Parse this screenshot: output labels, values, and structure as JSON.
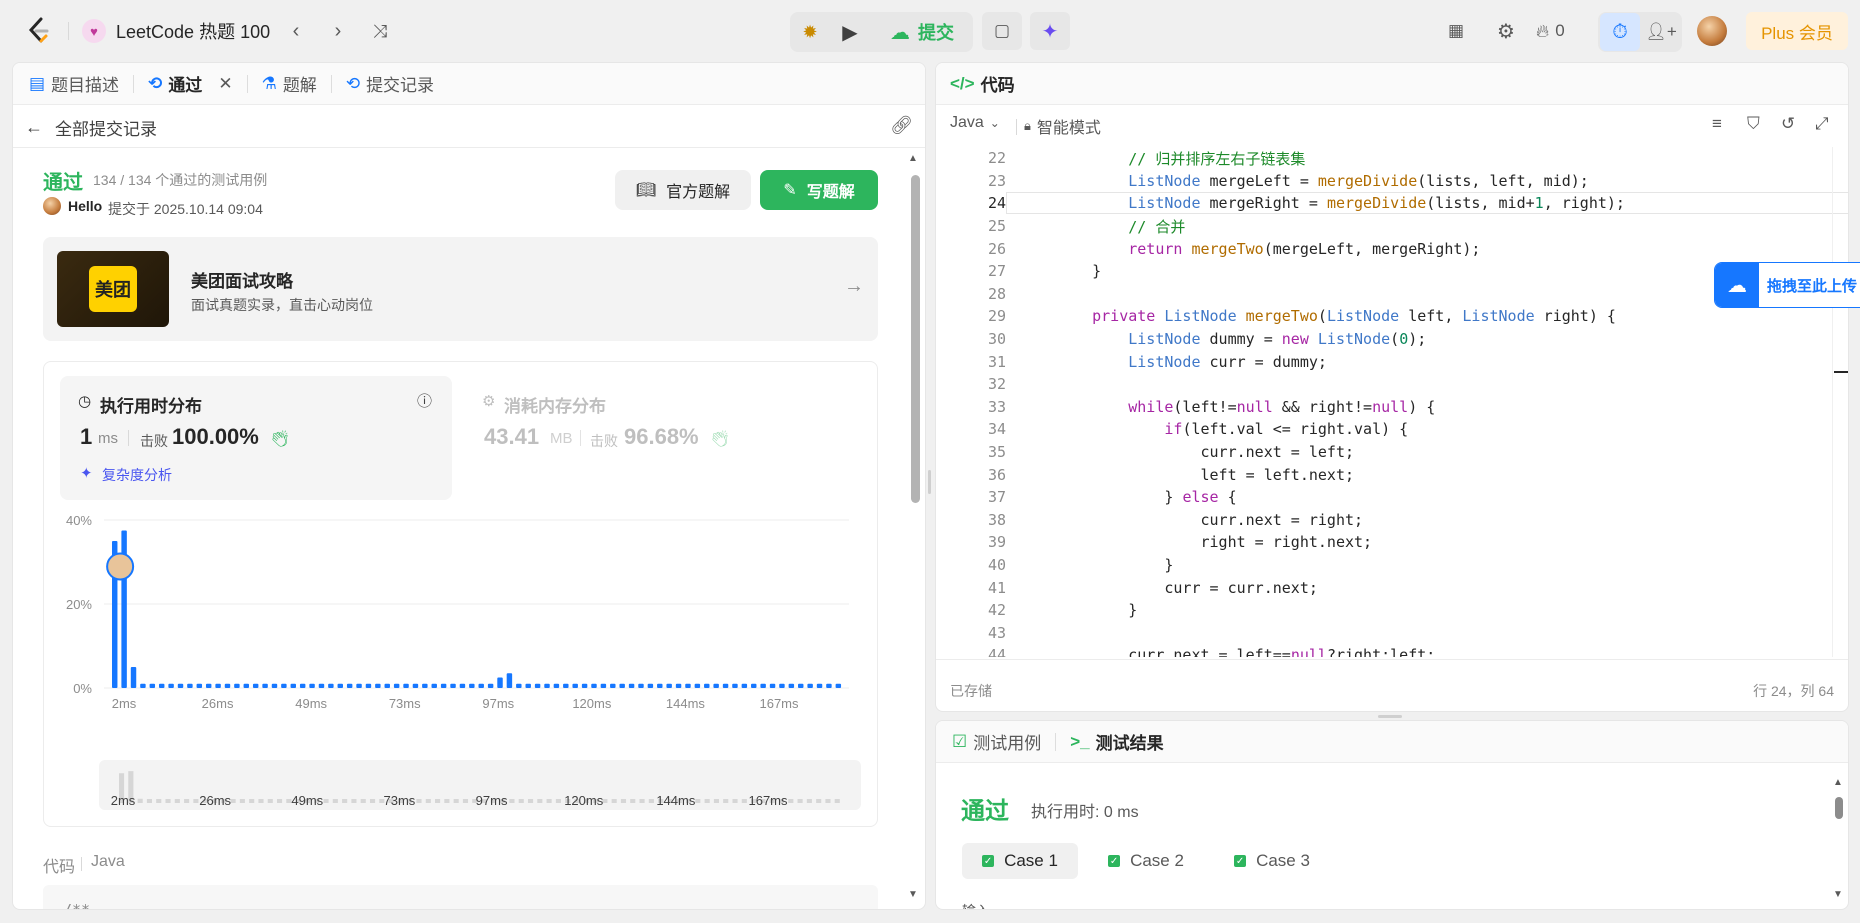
{
  "topbar": {
    "problem_list": "LeetCode 热题 100",
    "submit": "提交",
    "streak_count": "0",
    "plus": "Plus 会员"
  },
  "left": {
    "tabs": [
      "题目描述",
      "通过",
      "题解",
      "提交记录"
    ],
    "back_label": "全部提交记录",
    "status": "通过",
    "testcases": "134 / 134 个通过的测试用例",
    "user": "Hello",
    "submitted_at": "提交于 2025.10.14 09:04",
    "official_solution": "官方题解",
    "write_solution": "写题解",
    "promo_logo": "美团",
    "promo_title": "美团面试攻略",
    "promo_sub": "面试真题实录，直击心动岗位",
    "runtime_title": "执行用时分布",
    "runtime_value": "1",
    "runtime_unit": "ms",
    "beats_label": "击败",
    "runtime_beats": "100.00%",
    "complexity": "复杂度分析",
    "memory_title": "消耗内存分布",
    "memory_value": "43.41",
    "memory_unit": "MB",
    "memory_beats": "96.68%",
    "code_label": "代码",
    "code_lang": "Java",
    "code_peek": "/**"
  },
  "chart_data": {
    "type": "bar",
    "title": "执行用时分布",
    "xlabel": "",
    "ylabel": "",
    "ylim": [
      0,
      40
    ],
    "yticks": [
      "40%",
      "20%",
      "0%"
    ],
    "xticks": [
      "2ms",
      "26ms",
      "49ms",
      "73ms",
      "97ms",
      "120ms",
      "144ms",
      "167ms"
    ],
    "values": [
      35,
      37.5,
      5,
      1,
      1,
      1,
      1,
      1,
      1,
      1,
      1,
      1,
      1,
      1,
      1,
      1,
      1,
      1,
      1,
      1,
      1,
      1,
      1,
      1,
      1,
      1,
      1,
      1,
      1,
      1,
      1,
      1,
      1,
      1,
      1,
      1,
      1,
      1,
      1,
      1,
      1,
      2.5,
      3.5,
      1,
      1,
      1,
      1,
      1,
      1,
      1,
      1,
      1,
      1,
      1,
      1,
      1,
      1,
      1,
      1,
      1,
      1,
      1,
      1,
      1,
      1,
      1,
      1,
      1,
      1,
      1,
      1,
      1,
      1,
      1,
      1,
      1,
      1,
      1
    ],
    "highlight_index": 1
  },
  "editor": {
    "title": "代码",
    "lang": "Java",
    "mode": "智能模式",
    "saved": "已存储",
    "cursor": "行 24，列 64",
    "upload_hint": "拖拽至此上传",
    "lines": [
      {
        "n": "22",
        "t": "        // 归并排序左右子链表集"
      },
      {
        "n": "23",
        "t": "        ListNode mergeLeft = mergeDivide(lists, left, mid);"
      },
      {
        "n": "24",
        "t": "        ListNode mergeRight = mergeDivide(lists, mid+1, right);"
      },
      {
        "n": "25",
        "t": "        // 合并"
      },
      {
        "n": "26",
        "t": "        return mergeTwo(mergeLeft, mergeRight);"
      },
      {
        "n": "27",
        "t": "    }"
      },
      {
        "n": "28",
        "t": ""
      },
      {
        "n": "29",
        "t": "    private ListNode mergeTwo(ListNode left, ListNode right) {"
      },
      {
        "n": "30",
        "t": "        ListNode dummy = new ListNode(0);"
      },
      {
        "n": "31",
        "t": "        ListNode curr = dummy;"
      },
      {
        "n": "32",
        "t": ""
      },
      {
        "n": "33",
        "t": "        while(left!=null && right!=null) {"
      },
      {
        "n": "34",
        "t": "            if(left.val <= right.val) {"
      },
      {
        "n": "35",
        "t": "                curr.next = left;"
      },
      {
        "n": "36",
        "t": "                left = left.next;"
      },
      {
        "n": "37",
        "t": "            } else {"
      },
      {
        "n": "38",
        "t": "                curr.next = right;"
      },
      {
        "n": "39",
        "t": "                right = right.next;"
      },
      {
        "n": "40",
        "t": "            }"
      },
      {
        "n": "41",
        "t": "            curr = curr.next;"
      },
      {
        "n": "42",
        "t": "        }"
      },
      {
        "n": "43",
        "t": ""
      },
      {
        "n": "44",
        "t": "        curr.next = left==null?right:left;"
      }
    ]
  },
  "tests": {
    "tab_cases": "测试用例",
    "tab_result": "测试结果",
    "status": "通过",
    "runtime": "执行用时: 0 ms",
    "cases": [
      "Case 1",
      "Case 2",
      "Case 3"
    ],
    "input_label": "输入"
  },
  "colors": {
    "accent": "#2db55d",
    "bar": "#1677ff",
    "plus_bg": "#fff1dc",
    "plus_text": "#e59400"
  }
}
